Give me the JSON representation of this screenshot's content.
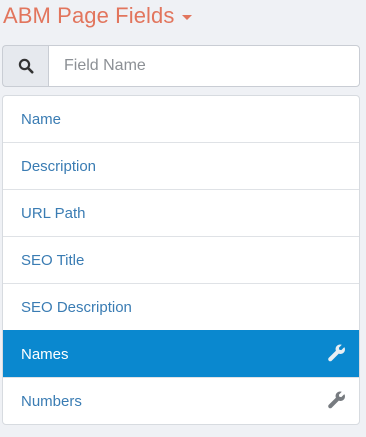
{
  "header": {
    "title": "ABM Page Fields"
  },
  "search": {
    "placeholder": "Field Name",
    "value": ""
  },
  "fields": [
    {
      "label": "Name",
      "active": false,
      "has_tool": false
    },
    {
      "label": "Description",
      "active": false,
      "has_tool": false
    },
    {
      "label": "URL Path",
      "active": false,
      "has_tool": false
    },
    {
      "label": "SEO Title",
      "active": false,
      "has_tool": false
    },
    {
      "label": "SEO Description",
      "active": false,
      "has_tool": false
    },
    {
      "label": "Names",
      "active": true,
      "has_tool": true,
      "tool_icon": "wrench-icon"
    },
    {
      "label": "Numbers",
      "active": false,
      "has_tool": true,
      "tool_icon": "wrench-icon"
    }
  ],
  "colors": {
    "title": "#e2755d",
    "link": "#3a7cb3",
    "active_bg": "#0a88cf",
    "background": "#eff1f5"
  }
}
